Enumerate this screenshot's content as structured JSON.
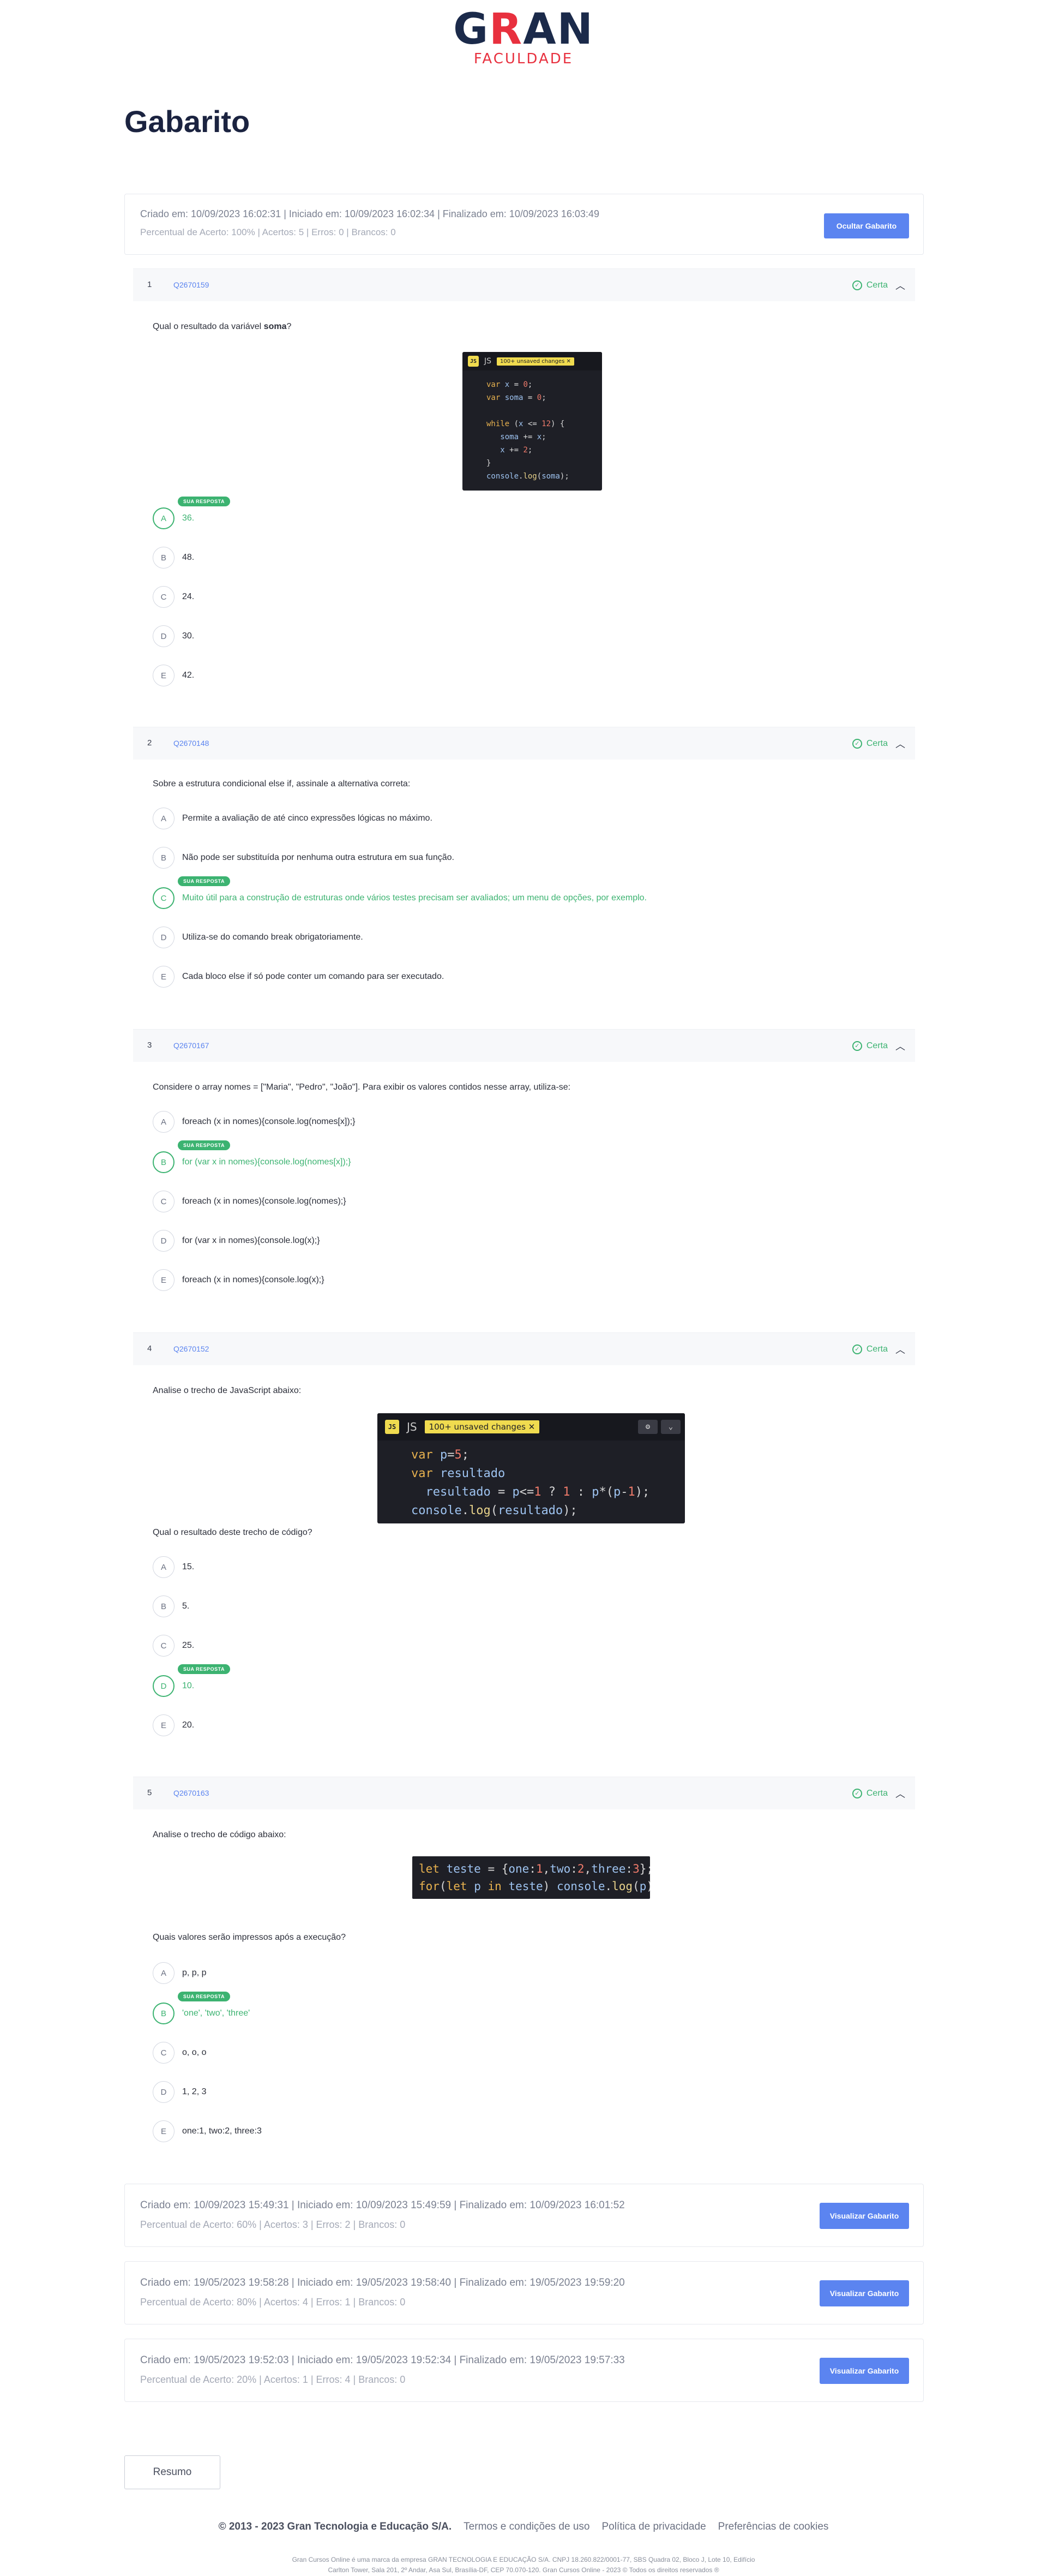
{
  "brand": {
    "logo_main_a": "G",
    "logo_main_r": "R",
    "logo_main_rest": "AN",
    "logo_sub": "FACULDADE"
  },
  "page_title": "Gabarito",
  "current_attempt": {
    "meta": "Criado em: 10/09/2023 16:02:31 | Iniciado em: 10/09/2023 16:02:34 | Finalizado em: 10/09/2023 16:03:49",
    "stats": "Percentual de Acerto: 100% | Acertos: 5 | Erros: 0 | Brancos: 0",
    "button": "Ocultar Gabarito"
  },
  "badge_label": "SUA RESPOSTA",
  "status_label": "Certa",
  "questions": [
    {
      "num": "1",
      "code": "Q2670159",
      "text_before": "Qual o resultado da variável ",
      "text_bold": "soma",
      "text_after": "?",
      "options": [
        "36.",
        "48.",
        "24.",
        "30.",
        "42."
      ]
    },
    {
      "num": "2",
      "code": "Q2670148",
      "text": "Sobre a estrutura condicional else if, assinale a alternativa correta:",
      "options": [
        "Permite a avaliação de até cinco expressões lógicas no máximo.",
        "Não pode ser substituída por nenhuma outra estrutura em sua função.",
        "Muito útil para a construção de estruturas onde vários testes precisam ser avaliados; um menu de opções, por exemplo.",
        "Utiliza-se do comando break obrigatoriamente.",
        "Cada bloco else if só pode conter um comando para ser executado."
      ]
    },
    {
      "num": "3",
      "code": "Q2670167",
      "text": "Considere o array nomes = [\"Maria\", \"Pedro\", \"João\"]. Para exibir os valores contidos nesse array, utiliza-se:",
      "options": [
        "foreach (x in nomes){console.log(nomes[x]);}",
        "for (var x in nomes){console.log(nomes[x]);}",
        "foreach (x in nomes){console.log(nomes);}",
        "for (var x in nomes){console.log(x);}",
        "foreach (x in nomes){console.log(x);}"
      ]
    },
    {
      "num": "4",
      "code": "Q2670152",
      "text": "Analise o trecho de JavaScript abaixo:",
      "text2": "Qual o resultado deste trecho de código?",
      "options": [
        "15.",
        "5.",
        "25.",
        "10.",
        "20."
      ]
    },
    {
      "num": "5",
      "code": "Q2670163",
      "text": "Analise o trecho de código abaixo:",
      "text2": "Quais valores serão impressos após a execução?",
      "options": [
        "p, p, p",
        "'one', 'two', 'three'",
        "o, o, o",
        "1, 2, 3",
        "one:1, two:2, three:3"
      ]
    }
  ],
  "letters": [
    "A",
    "B",
    "C",
    "D",
    "E"
  ],
  "code_editor": {
    "js_label": "JS",
    "unsaved": "100+ unsaved changes ✕"
  },
  "previous_attempts": [
    {
      "meta": "Criado em: 10/09/2023 15:49:31 | Iniciado em: 10/09/2023 15:49:59 | Finalizado em: 10/09/2023 16:01:52",
      "stats": "Percentual de Acerto: 60% | Acertos: 3 | Erros: 2 | Brancos: 0",
      "button": "Visualizar Gabarito"
    },
    {
      "meta": "Criado em: 19/05/2023 19:58:28 | Iniciado em: 19/05/2023 19:58:40 | Finalizado em: 19/05/2023 19:59:20",
      "stats": "Percentual de Acerto: 80% | Acertos: 4 | Erros: 1 | Brancos: 0",
      "button": "Visualizar Gabarito"
    },
    {
      "meta": "Criado em: 19/05/2023 19:52:03 | Iniciado em: 19/05/2023 19:52:34 | Finalizado em: 19/05/2023 19:57:33",
      "stats": "Percentual de Acerto: 20% | Acertos: 1 | Erros: 4 | Brancos: 0",
      "button": "Visualizar Gabarito"
    }
  ],
  "resumo_button": "Resumo",
  "footer": {
    "copyright": "© 2013 - 2023 Gran Tecnologia e Educação S/A.",
    "links": [
      "Termos e condições de uso",
      "Política de privacidade",
      "Preferências de cookies"
    ],
    "line1": "Gran Cursos Online é uma marca da empresa GRAN TECNOLOGIA E EDUCAÇÃO S/A. CNPJ 18.260.822/0001-77, SBS Quadra 02, Bloco J, Lote 10, Edifício",
    "line2": "Carlton Tower, Sala 201, 2º Andar, Asa Sul, Brasília-DF, CEP 70.070-120. Gran Cursos Online - 2023 © Todos os direitos reservados ®"
  },
  "colors": {
    "accent": "#5b84f0",
    "correct": "#3cb371",
    "brand_dark": "#1b2a4a",
    "brand_red": "#e8303e"
  }
}
